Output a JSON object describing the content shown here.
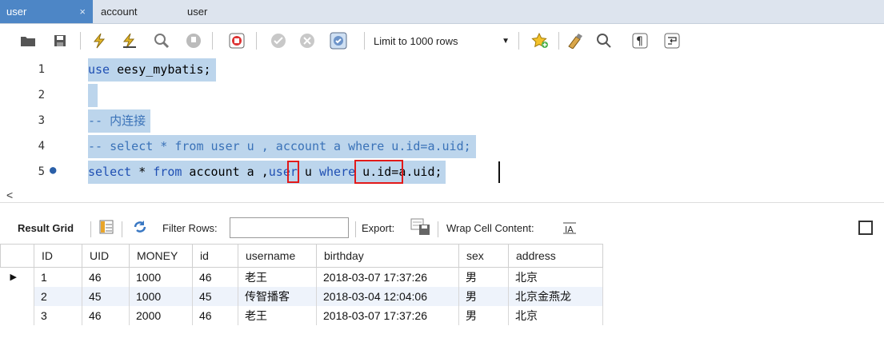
{
  "tabs": [
    {
      "label": "user",
      "close": "×",
      "active": true
    },
    {
      "label": "account",
      "active": false
    },
    {
      "label": "user",
      "active": false
    }
  ],
  "toolbar": {
    "limit_label": "Limit to 1000 rows",
    "icons": [
      "open-folder-icon",
      "save-icon",
      "execute-icon",
      "execute-current-icon",
      "explain-icon",
      "stop-icon",
      "toggle-stop-on-error-icon",
      "commit-icon",
      "rollback-icon",
      "autocommit-icon",
      "beautify-icon",
      "find-icon",
      "invisible-chars-icon",
      "word-wrap-icon",
      "bookmark-icon"
    ]
  },
  "editor": {
    "lines": [
      {
        "num": "1",
        "code": "use eesy_mybatis;"
      },
      {
        "num": "2",
        "code": ""
      },
      {
        "num": "3",
        "code": "-- 内连接"
      },
      {
        "num": "4",
        "code": "-- select * from user u , account a where u.id=a.uid;"
      },
      {
        "num": "5",
        "code": "select * from account a ,user u where u.id=a.uid;",
        "marker": "●"
      }
    ]
  },
  "results": {
    "result_grid_label": "Result Grid",
    "filter_label": "Filter Rows:",
    "filter_value": "",
    "export_label": "Export:",
    "wrap_label": "Wrap Cell Content:",
    "columns": [
      "ID",
      "UID",
      "MONEY",
      "id",
      "username",
      "birthday",
      "sex",
      "address"
    ],
    "rows": [
      [
        "1",
        "46",
        "1000",
        "46",
        "老王",
        "2018-03-07 17:37:26",
        "男",
        "北京"
      ],
      [
        "2",
        "45",
        "1000",
        "45",
        "传智播客",
        "2018-03-04 12:04:06",
        "男",
        "北京金燕龙"
      ],
      [
        "3",
        "46",
        "2000",
        "46",
        "老王",
        "2018-03-07 17:37:26",
        "男",
        "北京"
      ]
    ],
    "current_row_marker": "▶"
  },
  "colors": {
    "tab_active": "#4d86c6",
    "selection": "#bcd5ec",
    "keyword": "#1f4fb3",
    "comment": "#3a72b8",
    "highlight_box": "#e21a1a"
  }
}
